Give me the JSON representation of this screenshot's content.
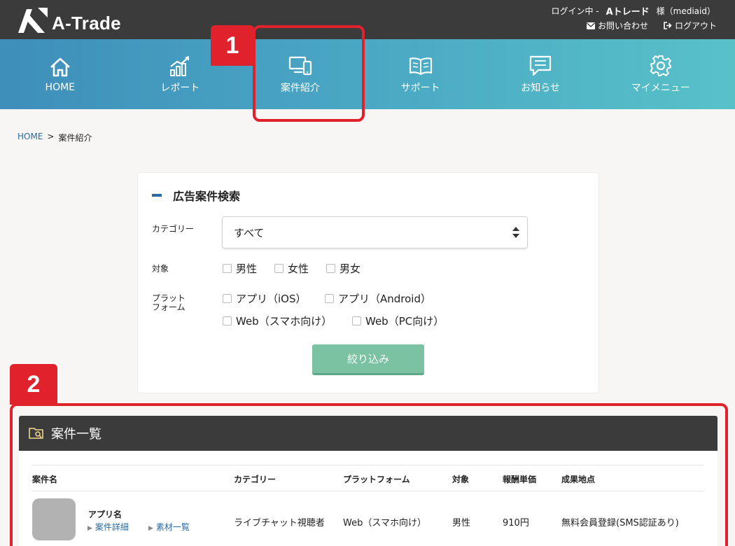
{
  "header": {
    "logo_text": "A-Trade",
    "login_status": "ログイン中 -",
    "user_name": "Aトレード",
    "user_suffix": "様（mediaid）",
    "contact_label": "お問い合わせ",
    "logout_label": "ログアウト"
  },
  "nav": {
    "items": [
      {
        "label": "HOME",
        "icon": "home-icon"
      },
      {
        "label": "レポート",
        "icon": "chart-icon"
      },
      {
        "label": "案件紹介",
        "icon": "devices-icon"
      },
      {
        "label": "サポート",
        "icon": "book-icon"
      },
      {
        "label": "お知らせ",
        "icon": "message-icon"
      },
      {
        "label": "マイメニュー",
        "icon": "gear-icon"
      }
    ]
  },
  "annotations": {
    "one": "1",
    "two": "2"
  },
  "breadcrumb": {
    "home": "HOME",
    "separator": ">",
    "current": "案件紹介"
  },
  "search": {
    "title": "広告案件検索",
    "category_label": "カテゴリー",
    "category_value": "すべて",
    "target_label": "対象",
    "target_options": [
      "男性",
      "女性",
      "男女"
    ],
    "platform_label_1": "プラット",
    "platform_label_2": "フォーム",
    "platform_options": [
      "アプリ（iOS）",
      "アプリ（Android）",
      "Web（スマホ向け）",
      "Web（PC向け）"
    ],
    "filter_button": "絞り込み"
  },
  "list": {
    "title": "案件一覧",
    "columns": [
      "案件名",
      "カテゴリー",
      "プラットフォーム",
      "対象",
      "報酬単価",
      "成果地点"
    ],
    "rows": [
      {
        "app_name": "アプリ名",
        "detail_link": "案件詳細",
        "material_link": "素材一覧",
        "category": "ライブチャット視聴者",
        "platform": "Web（スマホ向け）",
        "target": "男性",
        "reward": "910円",
        "conversion": "無料会員登録(SMS認証あり)"
      }
    ]
  },
  "colors": {
    "accent_red": "#e0222d",
    "nav_start": "#3e8fba",
    "nav_end": "#58c1c8",
    "button_green": "#7bc2a2",
    "dark": "#3b3b3b"
  }
}
